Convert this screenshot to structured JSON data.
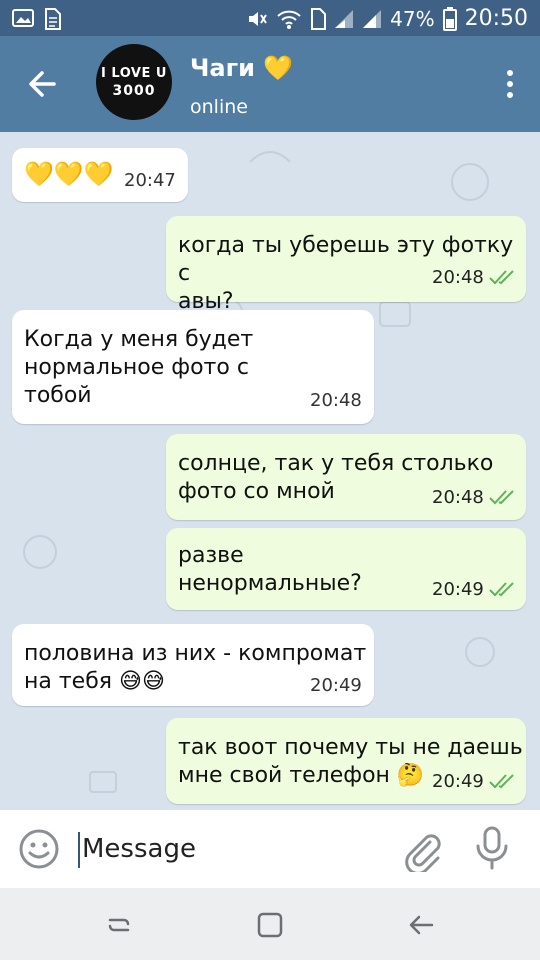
{
  "status_bar": {
    "battery": "47%",
    "time": "20:50"
  },
  "header": {
    "title": "Чаги 💛",
    "status": "online",
    "avatar_line1": "I LOVE U",
    "avatar_line2": "3000"
  },
  "messages": [
    {
      "dir": "in",
      "text": "💛💛💛",
      "time": "20:47"
    },
    {
      "dir": "out",
      "text": "когда ты уберешь эту фотку с\nавы?",
      "time": "20:48",
      "read": true
    },
    {
      "dir": "in",
      "text": "Когда у меня будет\nнормальное фото с\nтобой",
      "time": "20:48"
    },
    {
      "dir": "out",
      "text": "солнце, так у тебя столько\nфото со мной",
      "time": "20:48",
      "read": true
    },
    {
      "dir": "out",
      "text": "разве\nненормальные?",
      "time": "20:49",
      "read": true
    },
    {
      "dir": "in",
      "text": "половина из них - компромат\nна тебя 😅😅",
      "time": "20:49"
    },
    {
      "dir": "out",
      "text": "так воот почему ты не даешь\nмне свой телефон 🤔",
      "time": "20:49",
      "read": true
    }
  ],
  "composer": {
    "placeholder": "Message"
  },
  "colors": {
    "header": "#517da2",
    "status_bar": "#3f6186",
    "out_bubble": "#effdde",
    "in_bubble": "#ffffff",
    "check": "#5fb25a"
  }
}
